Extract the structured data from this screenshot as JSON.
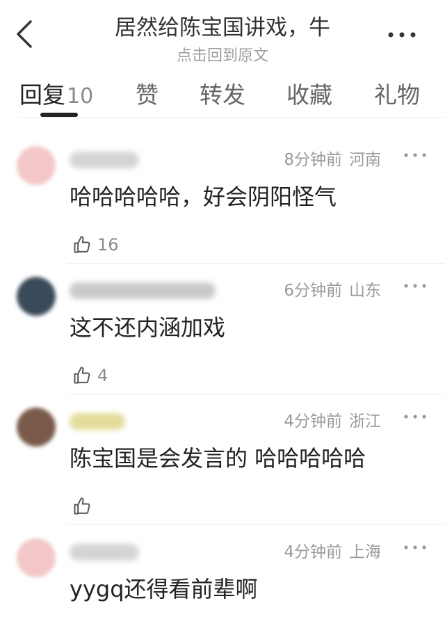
{
  "header": {
    "title": "居然给陈宝国讲戏，牛",
    "subtitle": "点击回到原文"
  },
  "tabs": [
    {
      "label": "回复",
      "count": "10",
      "active": true
    },
    {
      "label": "赞"
    },
    {
      "label": "转发"
    },
    {
      "label": "收藏"
    },
    {
      "label": "礼物"
    }
  ],
  "comments": [
    {
      "time": "8分钟前",
      "location": "河南",
      "text": "哈哈哈哈哈，好会阴阳怪气",
      "likes": "16",
      "avatar_color": "#f3c7c7"
    },
    {
      "time": "6分钟前",
      "location": "山东",
      "text": "这不还内涵加戏",
      "likes": "4",
      "avatar_color": "#3b4a5a"
    },
    {
      "time": "4分钟前",
      "location": "浙江",
      "text": "陈宝国是会发言的 哈哈哈哈哈",
      "likes": "",
      "avatar_color": "#7a5a4a"
    },
    {
      "time": "4分钟前",
      "location": "上海",
      "text": "yygq还得看前辈啊",
      "likes": "",
      "avatar_color": "#f3c7c7"
    }
  ]
}
